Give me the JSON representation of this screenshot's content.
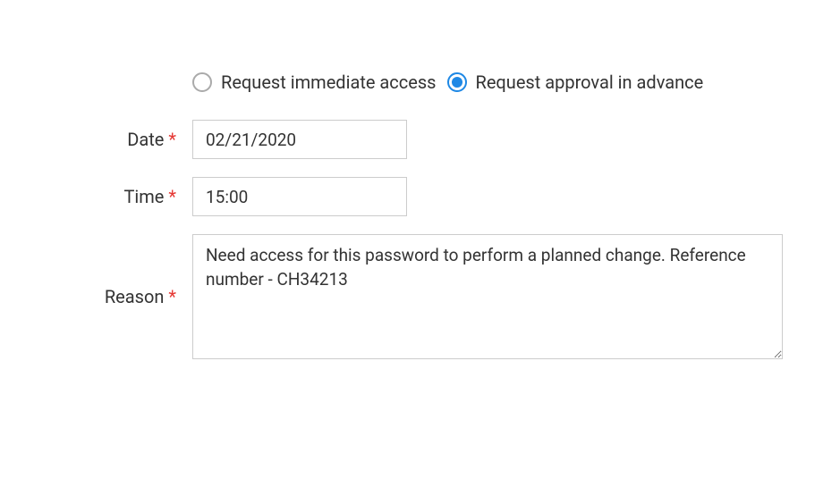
{
  "radio": {
    "immediate": {
      "label": "Request immediate access",
      "checked": false
    },
    "advance": {
      "label": "Request approval in advance",
      "checked": true
    }
  },
  "fields": {
    "date": {
      "label": "Date",
      "required": "*",
      "value": "02/21/2020"
    },
    "time": {
      "label": "Time",
      "required": "*",
      "value": "15:00"
    },
    "reason": {
      "label": "Reason",
      "required": "*",
      "value": "Need access for this password to perform a planned change. Reference number - CH34213"
    }
  }
}
